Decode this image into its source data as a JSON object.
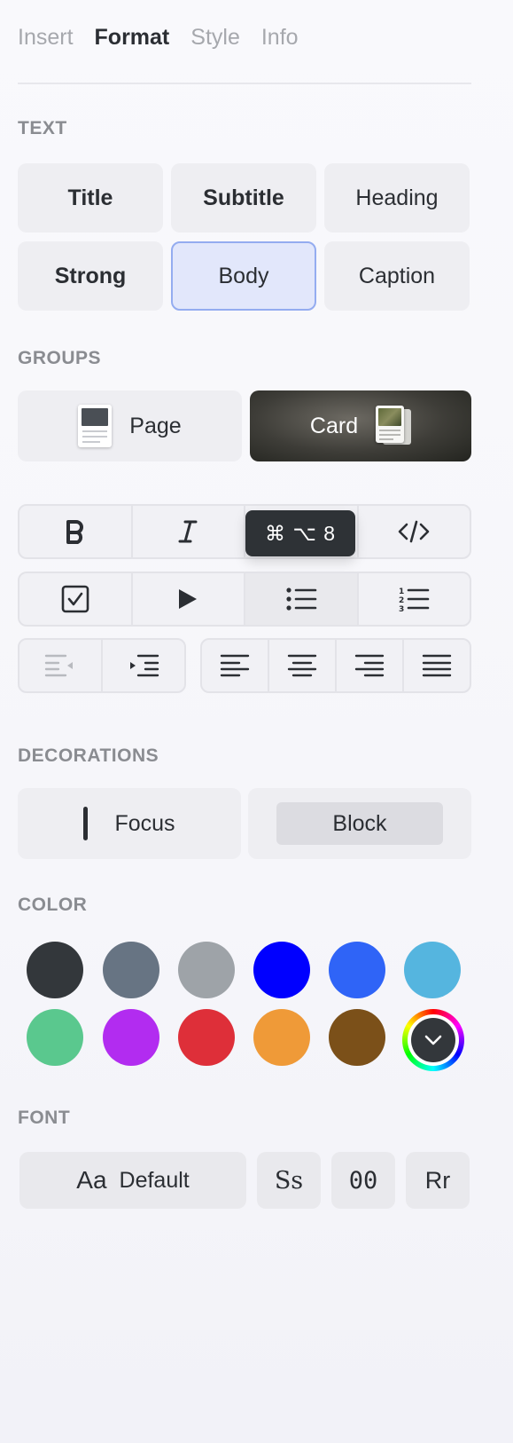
{
  "tabs": [
    {
      "label": "Insert"
    },
    {
      "label": "Format"
    },
    {
      "label": "Style"
    },
    {
      "label": "Info"
    }
  ],
  "active_tab": "Format",
  "sections": {
    "text": "TEXT",
    "groups": "GROUPS",
    "decorations": "DECORATIONS",
    "color": "COLOR",
    "font": "FONT"
  },
  "text_styles": [
    {
      "label": "Title"
    },
    {
      "label": "Subtitle"
    },
    {
      "label": "Heading"
    },
    {
      "label": "Strong"
    },
    {
      "label": "Body"
    },
    {
      "label": "Caption"
    }
  ],
  "selected_text_style": "Body",
  "groups": [
    {
      "label": "Page",
      "icon": "page-doc-icon"
    },
    {
      "label": "Card",
      "icon": "card-stack-icon"
    }
  ],
  "tooltip": "⌘ ⌥ 8",
  "toolbar": {
    "row1": [
      "bold-icon",
      "italic-icon",
      "strikethrough-icon",
      "code-icon"
    ],
    "row2": [
      "checklist-icon",
      "toggle-icon",
      "bullet-list-icon",
      "numbered-list-icon"
    ],
    "indent": [
      "outdent-icon",
      "indent-icon"
    ],
    "align": [
      "align-left-icon",
      "align-center-icon",
      "align-right-icon",
      "align-justify-icon"
    ]
  },
  "decorations": [
    {
      "label": "Focus"
    },
    {
      "label": "Block"
    }
  ],
  "colors": [
    "#33373b",
    "#677483",
    "#9ea3a8",
    "#0000ff",
    "#2f64f7",
    "#55b5df",
    "#5ac88e",
    "#b22cf0",
    "#de2f39",
    "#ef9a38",
    "#7b5019"
  ],
  "fonts": {
    "default_sample": "Aa",
    "default_label": "Default",
    "serif": "Ss",
    "mono": "00",
    "rounded": "Rr"
  }
}
